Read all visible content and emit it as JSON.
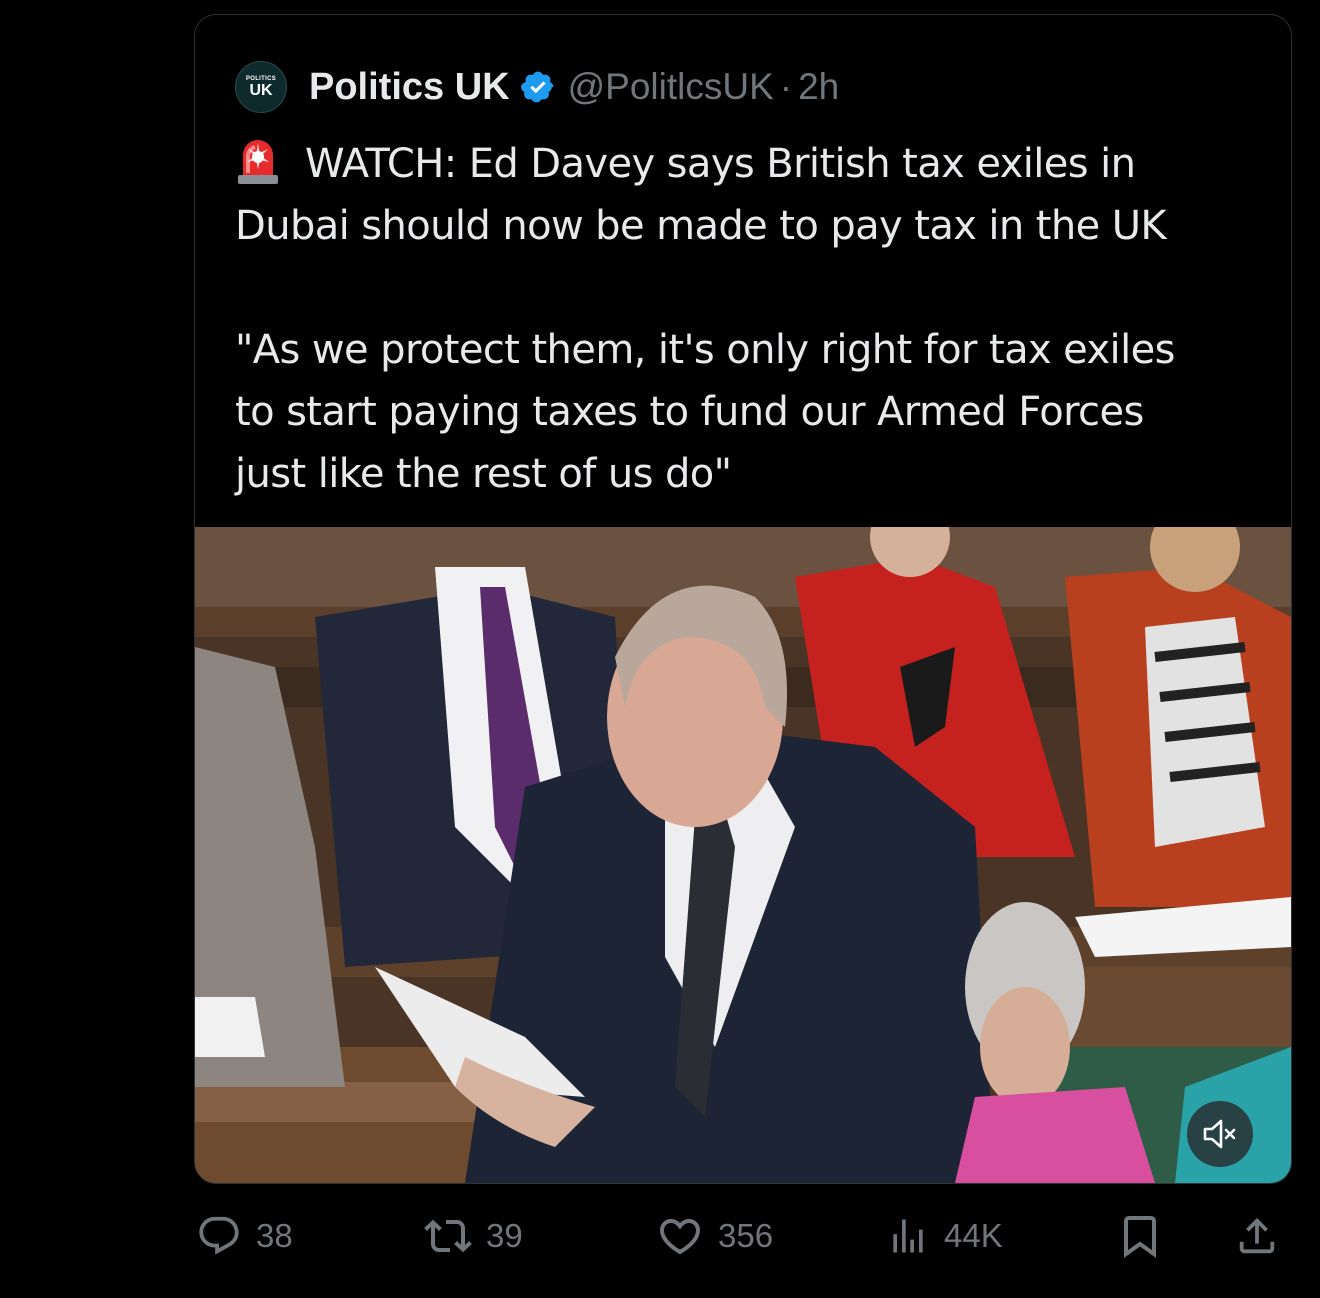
{
  "tweet": {
    "author_name": "Politics UK",
    "avatar_top": "POLITICS",
    "avatar_bottom": "UK",
    "handle": "@PolitlcsUK",
    "separator": "·",
    "time": "2h",
    "verified": true,
    "line1": "WATCH: Ed Davey says British tax exiles in",
    "line2": "Dubai should now be made to pay tax in the UK",
    "quote_line1": "\"As we protect them, it's only right for tax exiles",
    "quote_line2": "to start paying taxes to fund our Armed Forces",
    "quote_line3": "just like the rest of us do\"",
    "emoji": "police-car-light"
  },
  "media": {
    "type": "video",
    "muted": true,
    "description_icon": "speaker-muted-icon"
  },
  "actions": {
    "replies": "38",
    "reposts": "39",
    "likes": "356",
    "views": "44K"
  },
  "colors": {
    "background": "#000000",
    "text": "#e7e9ea",
    "secondary": "#71767b",
    "verified": "#1d9bf0",
    "border": "#2f3336"
  }
}
